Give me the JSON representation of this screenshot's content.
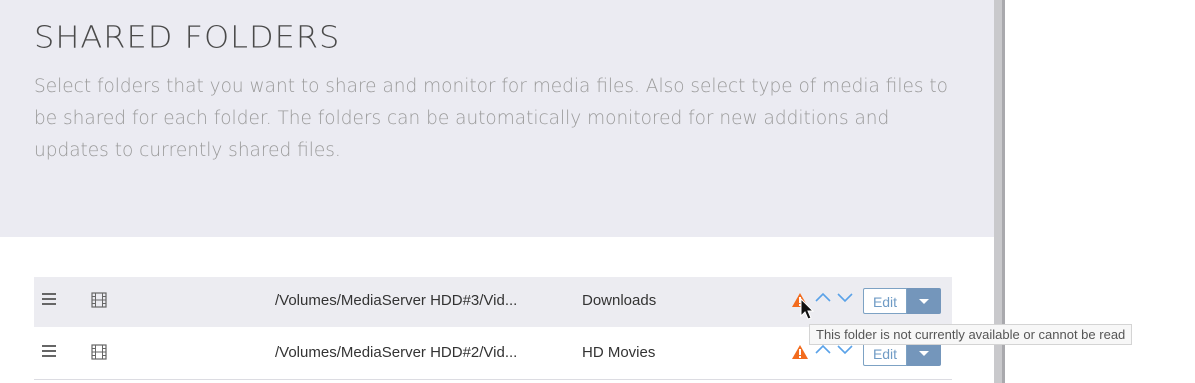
{
  "header": {
    "title": "SHARED FOLDERS",
    "description": "Select folders that you want to share and monitor for media files. Also select type of media files to be shared for each folder. The folders can be automatically monitored for new additions and updates to currently shared files."
  },
  "folders": [
    {
      "path": "/Volumes/MediaServer HDD#3/Vid...",
      "name": "Downloads",
      "status_icon": "warning-icon",
      "edit_label": "Edit"
    },
    {
      "path": "/Volumes/MediaServer HDD#2/Vid...",
      "name": "HD Movies",
      "status_icon": "warning-icon",
      "edit_label": "Edit"
    }
  ],
  "tooltip": {
    "text": "This folder is not currently available or cannot be read"
  },
  "colors": {
    "header_bg": "#ebebf2",
    "warning": "#f26b1d",
    "accent": "#7496bb",
    "chevron": "#5aa2e8"
  }
}
